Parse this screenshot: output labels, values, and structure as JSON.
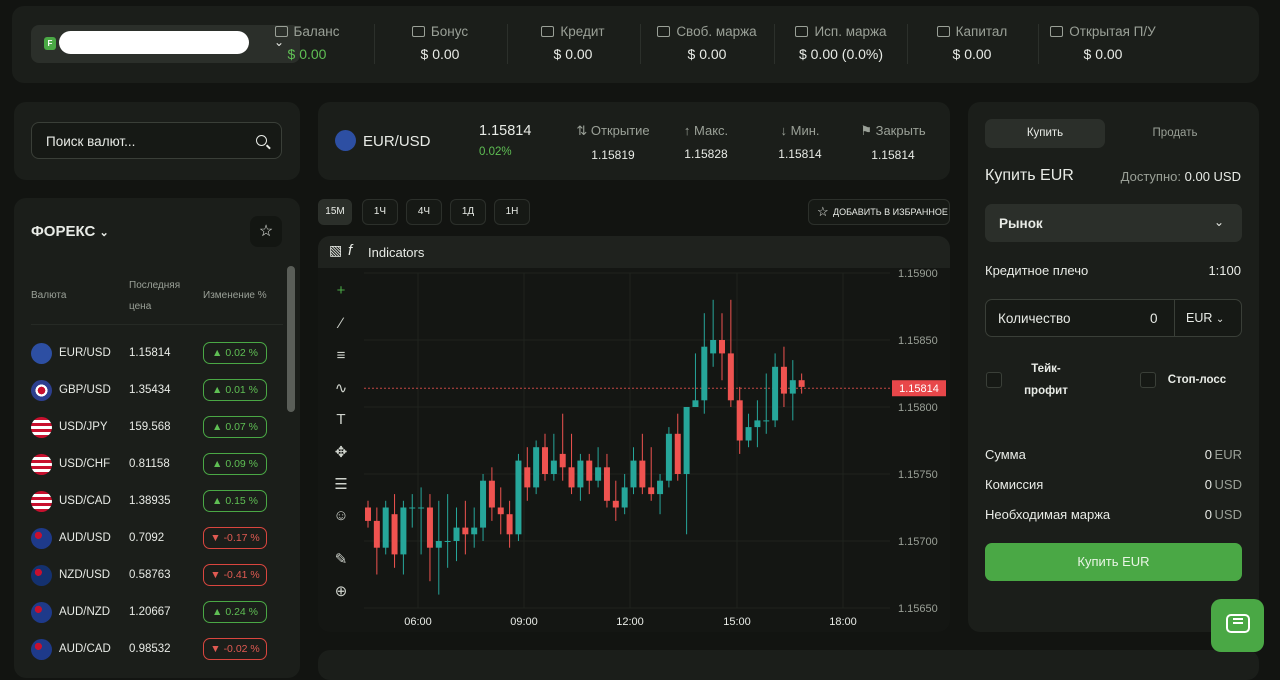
{
  "account": {
    "badge": "F"
  },
  "stats": [
    {
      "label": "Баланс",
      "value": "$ 0.00",
      "green": true,
      "icon": "wallet-icon"
    },
    {
      "label": "Бонус",
      "value": "$ 0.00",
      "icon": "gift-icon"
    },
    {
      "label": "Кредит",
      "value": "$ 0.00",
      "icon": "briefcase-icon"
    },
    {
      "label": "Своб. маржа",
      "value": "$ 0.00",
      "icon": "document-icon"
    },
    {
      "label": "Исп. маржа",
      "value": "$ 0.00 (0.0%)",
      "icon": "cash-icon"
    },
    {
      "label": "Капитал",
      "value": "$ 0.00",
      "icon": "capital-icon"
    },
    {
      "label": "Открытая П/У",
      "value": "$ 0.00",
      "icon": "arrows-updown-icon"
    }
  ],
  "search": {
    "placeholder": "Поиск валют..."
  },
  "forex": {
    "title": "ФОРЕКС",
    "col_currency": "Валюта",
    "col_last_price": "Последняя цена",
    "col_change": "Изменение %",
    "rows": [
      {
        "pair": "EUR/USD",
        "price": "1.15814",
        "change": "0.02",
        "dir": "up",
        "flag": "eu"
      },
      {
        "pair": "GBP/USD",
        "price": "1.35434",
        "change": "0.01",
        "dir": "up",
        "flag": "gb"
      },
      {
        "pair": "USD/JPY",
        "price": "159.568",
        "change": "0.07",
        "dir": "up",
        "flag": "us"
      },
      {
        "pair": "USD/CHF",
        "price": "0.81158",
        "change": "0.09",
        "dir": "up",
        "flag": "us"
      },
      {
        "pair": "USD/CAD",
        "price": "1.38935",
        "change": "0.15",
        "dir": "up",
        "flag": "us"
      },
      {
        "pair": "AUD/USD",
        "price": "0.7092",
        "change": "-0.17",
        "dir": "dn",
        "flag": "au"
      },
      {
        "pair": "NZD/USD",
        "price": "0.58763",
        "change": "-0.41",
        "dir": "dn",
        "flag": "nz"
      },
      {
        "pair": "AUD/NZD",
        "price": "1.20667",
        "change": "0.24",
        "dir": "up",
        "flag": "au"
      },
      {
        "pair": "AUD/CAD",
        "price": "0.98532",
        "change": "-0.02",
        "dir": "dn",
        "flag": "au"
      }
    ]
  },
  "instrument": {
    "name": "EUR/USD",
    "price": "1.15814",
    "change": "0.02%",
    "open_label": "Открытие",
    "open": "1.15819",
    "high_label": "Макс.",
    "high": "1.15828",
    "low_label": "Мин.",
    "low": "1.15814",
    "close_label": "Закрыть",
    "close": "1.15814"
  },
  "timeframes": [
    "15M",
    "1Ч",
    "4Ч",
    "1Д",
    "1Н"
  ],
  "active_timeframe": "15M",
  "favorite_label": "ДОБАВИТЬ В ИЗБРАННОЕ",
  "chart_toolbar": {
    "indicators": "Indicators"
  },
  "chart_data": {
    "type": "candlestick",
    "x_tick_labels": [
      "06:00",
      "09:00",
      "12:00",
      "15:00",
      "18:00"
    ],
    "y_tick_labels": [
      "1.15900",
      "1.15850",
      "1.15800",
      "1.15750",
      "1.15700",
      "1.15650"
    ],
    "ylim": [
      1.1565,
      1.159
    ],
    "current_price_label": "1.15814",
    "current_price": 1.15814,
    "colors": {
      "up": "#26a69a",
      "down": "#ef5350"
    },
    "candles": [
      [
        1.15725,
        1.1573,
        1.1571,
        1.15715
      ],
      [
        1.15715,
        1.15725,
        1.15675,
        1.15695
      ],
      [
        1.15695,
        1.1573,
        1.1569,
        1.15725
      ],
      [
        1.1572,
        1.15735,
        1.1568,
        1.1569
      ],
      [
        1.1569,
        1.1573,
        1.15675,
        1.15725
      ],
      [
        1.15725,
        1.15735,
        1.1571,
        1.15725
      ],
      [
        1.15725,
        1.1574,
        1.1569,
        1.15725
      ],
      [
        1.15725,
        1.15735,
        1.1567,
        1.15695
      ],
      [
        1.15695,
        1.1573,
        1.1566,
        1.157
      ],
      [
        1.157,
        1.15735,
        1.1568,
        1.157
      ],
      [
        1.157,
        1.15725,
        1.15685,
        1.1571
      ],
      [
        1.1571,
        1.1573,
        1.1569,
        1.15705
      ],
      [
        1.15705,
        1.15725,
        1.15695,
        1.1571
      ],
      [
        1.1571,
        1.1575,
        1.157,
        1.15745
      ],
      [
        1.15745,
        1.15755,
        1.15715,
        1.15725
      ],
      [
        1.15725,
        1.1574,
        1.15705,
        1.1572
      ],
      [
        1.1572,
        1.1573,
        1.15695,
        1.15705
      ],
      [
        1.15705,
        1.15765,
        1.157,
        1.1576
      ],
      [
        1.15755,
        1.1577,
        1.1573,
        1.1574
      ],
      [
        1.1574,
        1.15775,
        1.15735,
        1.1577
      ],
      [
        1.1577,
        1.1578,
        1.15745,
        1.1575
      ],
      [
        1.1575,
        1.1578,
        1.15745,
        1.1576
      ],
      [
        1.15765,
        1.15795,
        1.15745,
        1.15755
      ],
      [
        1.15755,
        1.1578,
        1.15735,
        1.1574
      ],
      [
        1.1574,
        1.15765,
        1.1573,
        1.1576
      ],
      [
        1.1576,
        1.15765,
        1.15735,
        1.15745
      ],
      [
        1.15745,
        1.1577,
        1.1574,
        1.15755
      ],
      [
        1.15755,
        1.15765,
        1.15725,
        1.1573
      ],
      [
        1.1573,
        1.15745,
        1.15715,
        1.15725
      ],
      [
        1.15725,
        1.1575,
        1.1572,
        1.1574
      ],
      [
        1.1574,
        1.1577,
        1.15735,
        1.1576
      ],
      [
        1.1576,
        1.1578,
        1.15735,
        1.1574
      ],
      [
        1.1574,
        1.1577,
        1.1573,
        1.15735
      ],
      [
        1.15735,
        1.1575,
        1.1572,
        1.15745
      ],
      [
        1.15745,
        1.15785,
        1.1574,
        1.1578
      ],
      [
        1.1578,
        1.15795,
        1.15745,
        1.1575
      ],
      [
        1.1575,
        1.1579,
        1.15705,
        1.158
      ],
      [
        1.158,
        1.1584,
        1.158,
        1.15805
      ],
      [
        1.15805,
        1.1587,
        1.15795,
        1.15845
      ],
      [
        1.1584,
        1.1588,
        1.1583,
        1.1585
      ],
      [
        1.1585,
        1.1587,
        1.1582,
        1.1584
      ],
      [
        1.1584,
        1.1588,
        1.158,
        1.15805
      ],
      [
        1.15805,
        1.15815,
        1.15765,
        1.15775
      ],
      [
        1.15775,
        1.15795,
        1.1577,
        1.15785
      ],
      [
        1.15785,
        1.15805,
        1.1577,
        1.1579
      ],
      [
        1.1579,
        1.15825,
        1.1578,
        1.1579
      ],
      [
        1.1579,
        1.1584,
        1.15785,
        1.1583
      ],
      [
        1.1583,
        1.15845,
        1.158,
        1.1581
      ],
      [
        1.1581,
        1.15835,
        1.1579,
        1.1582
      ],
      [
        1.1582,
        1.15825,
        1.1581,
        1.15815
      ]
    ]
  },
  "order": {
    "buy_tab": "Купить",
    "sell_tab": "Продать",
    "title": "Купить EUR",
    "available_label": "Доступно:",
    "available_value": "0.00 USD",
    "order_type": "Рынок",
    "leverage_label": "Кредитное плечо",
    "leverage_value": "1:100",
    "quantity_label": "Количество",
    "quantity_value": "0",
    "quantity_currency": "EUR",
    "take_profit_1": "Тейк-",
    "take_profit_2": "профит",
    "stop_loss": "Стоп-лосс",
    "sum_label": "Сумма",
    "sum_value": "0",
    "sum_unit": "EUR",
    "commission_label": "Комиссия",
    "commission_value": "0",
    "commission_unit": "USD",
    "margin_label": "Необходимая маржа",
    "margin_value": "0",
    "margin_unit": "USD",
    "submit": "Купить EUR"
  }
}
